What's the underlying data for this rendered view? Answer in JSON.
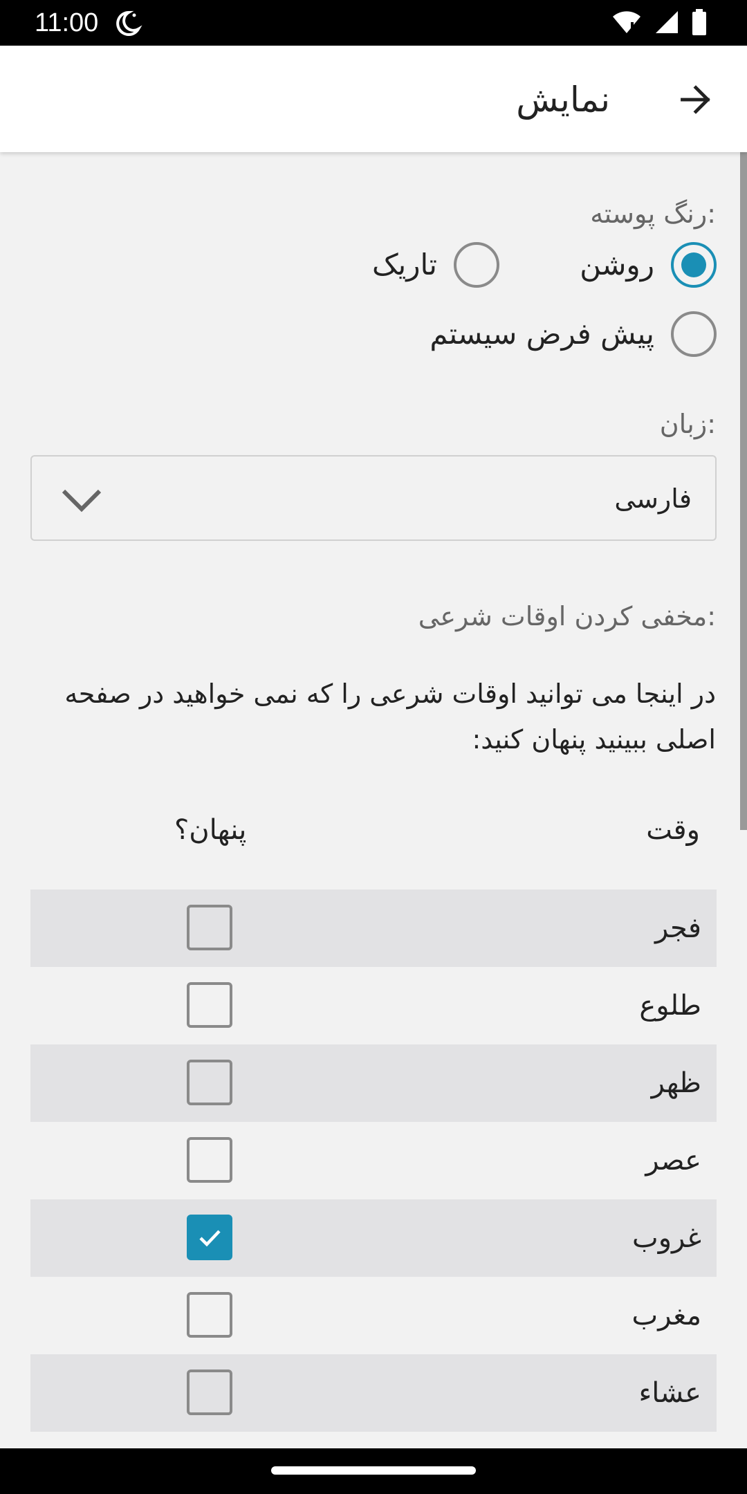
{
  "status_bar": {
    "time": "11:00",
    "icons": [
      "moon-icon",
      "wifi-icon",
      "signal-icon",
      "battery-icon"
    ]
  },
  "app_bar": {
    "title": "نمایش",
    "back_icon": "arrow-right-icon"
  },
  "theme": {
    "label": "رنگ پوسته:",
    "options": [
      {
        "label": "روشن",
        "checked": true
      },
      {
        "label": "تاریک",
        "checked": false
      },
      {
        "label": "پیش فرض سیستم",
        "checked": false
      }
    ]
  },
  "language": {
    "label": "زبان:",
    "selected": "فارسی"
  },
  "hide_times": {
    "label": "مخفی کردن اوقات شرعی:",
    "description": "در اینجا می توانید اوقات شرعی را که نمی خواهید در صفحه اصلی ببینید پنهان کنید:",
    "column_time": "وقت",
    "column_hidden": "پنهان؟",
    "rows": [
      {
        "label": "فجر",
        "hidden": false
      },
      {
        "label": "طلوع",
        "hidden": false
      },
      {
        "label": "ظهر",
        "hidden": false
      },
      {
        "label": "عصر",
        "hidden": false
      },
      {
        "label": "غروب",
        "hidden": true
      },
      {
        "label": "مغرب",
        "hidden": false
      },
      {
        "label": "عشاء",
        "hidden": false
      }
    ]
  },
  "colors": {
    "accent": "#1a8fb5",
    "row_shade": "#e2e2e4",
    "background": "#f2f2f2"
  }
}
